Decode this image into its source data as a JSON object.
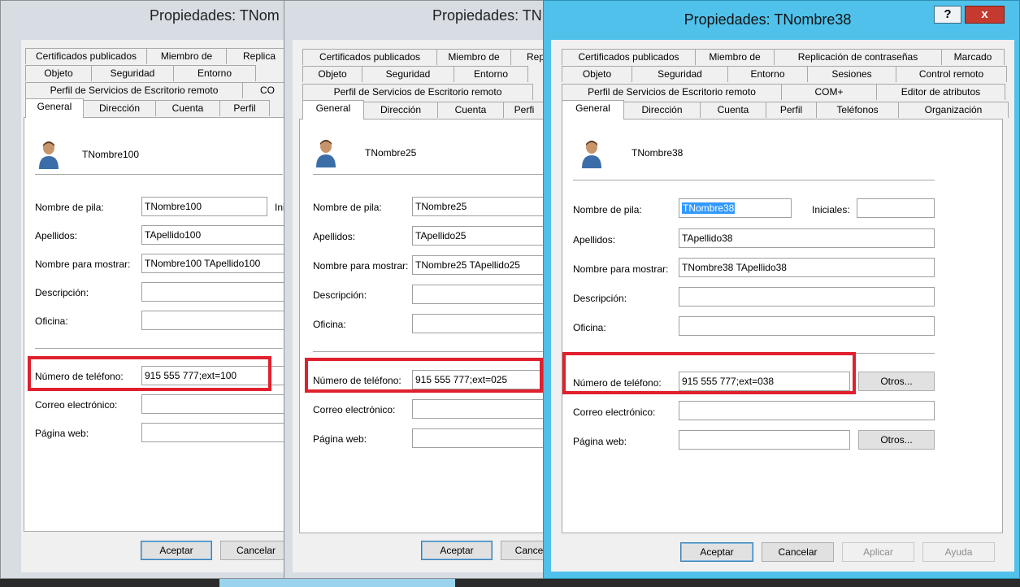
{
  "dialogs": [
    {
      "title": "Propiedades: TNom",
      "tabs_row1": [
        "Certificados publicados",
        "Miembro de",
        "Replica"
      ],
      "tabs_row2": [
        "Objeto",
        "Seguridad",
        "Entorno"
      ],
      "tabs_row3": [
        "Perfil de Servicios de Escritorio remoto",
        "CO"
      ],
      "tabs_row4": [
        "General",
        "Dirección",
        "Cuenta",
        "Perfil"
      ],
      "user_name": "TNombre100",
      "labels": {
        "first_name": "Nombre de pila:",
        "initials": "Ini",
        "last_name": "Apellidos:",
        "display_name": "Nombre para mostrar:",
        "description": "Descripción:",
        "office": "Oficina:",
        "phone": "Número de teléfono:",
        "email": "Correo electrónico:",
        "web": "Página web:"
      },
      "values": {
        "first_name": "TNombre100",
        "last_name": "TApellido100",
        "display_name": "TNombre100 TApellido100",
        "description": "",
        "office": "",
        "phone": "915 555 777;ext=100",
        "email": "",
        "web": ""
      },
      "buttons": {
        "ok": "Aceptar",
        "cancel": "Cancelar"
      }
    },
    {
      "title": "Propiedades: TN",
      "tabs_row1": [
        "Certificados publicados",
        "Miembro de",
        "Rep"
      ],
      "tabs_row2": [
        "Objeto",
        "Seguridad",
        "Entorno"
      ],
      "tabs_row3": [
        "Perfil de Servicios de Escritorio remoto"
      ],
      "tabs_row4": [
        "General",
        "Dirección",
        "Cuenta",
        "Perfi"
      ],
      "user_name": "TNombre25",
      "labels": {
        "first_name": "Nombre de pila:",
        "last_name": "Apellidos:",
        "display_name": "Nombre para mostrar:",
        "description": "Descripción:",
        "office": "Oficina:",
        "phone": "Número de teléfono:",
        "email": "Correo electrónico:",
        "web": "Página web:"
      },
      "values": {
        "first_name": "TNombre25",
        "last_name": "TApellido25",
        "display_name": "TNombre25 TApellido25",
        "description": "",
        "office": "",
        "phone": "915 555 777;ext=025",
        "email": "",
        "web": ""
      },
      "buttons": {
        "ok": "Aceptar",
        "cancel": "Cance"
      }
    },
    {
      "title": "Propiedades: TNombre38",
      "caption_help": "?",
      "caption_close": "x",
      "tabs_row1": [
        "Certificados publicados",
        "Miembro de",
        "Replicación de contraseñas",
        "Marcado"
      ],
      "tabs_row2": [
        "Objeto",
        "Seguridad",
        "Entorno",
        "Sesiones",
        "Control remoto"
      ],
      "tabs_row3": [
        "Perfil de Servicios de Escritorio remoto",
        "COM+",
        "Editor de atributos"
      ],
      "tabs_row4": [
        "General",
        "Dirección",
        "Cuenta",
        "Perfil",
        "Teléfonos",
        "Organización"
      ],
      "user_name": "TNombre38",
      "labels": {
        "first_name": "Nombre de pila:",
        "initials": "Iniciales:",
        "last_name": "Apellidos:",
        "display_name": "Nombre para mostrar:",
        "description": "Descripción:",
        "office": "Oficina:",
        "phone": "Número de teléfono:",
        "email": "Correo electrónico:",
        "web": "Página web:"
      },
      "values": {
        "first_name": "TNombre38",
        "initials": "",
        "last_name": "TApellido38",
        "display_name": "TNombre38 TApellido38",
        "description": "",
        "office": "",
        "phone": "915 555 777;ext=038",
        "email": "",
        "web": ""
      },
      "buttons": {
        "others": "Otros...",
        "ok": "Aceptar",
        "cancel": "Cancelar",
        "apply": "Aplicar",
        "help": "Ayuda"
      }
    }
  ],
  "colors": {
    "active_frame": "#4fc1ea",
    "inactive_frame": "#d7dde3",
    "highlight": "#e0202d",
    "selection": "#3399ff"
  }
}
